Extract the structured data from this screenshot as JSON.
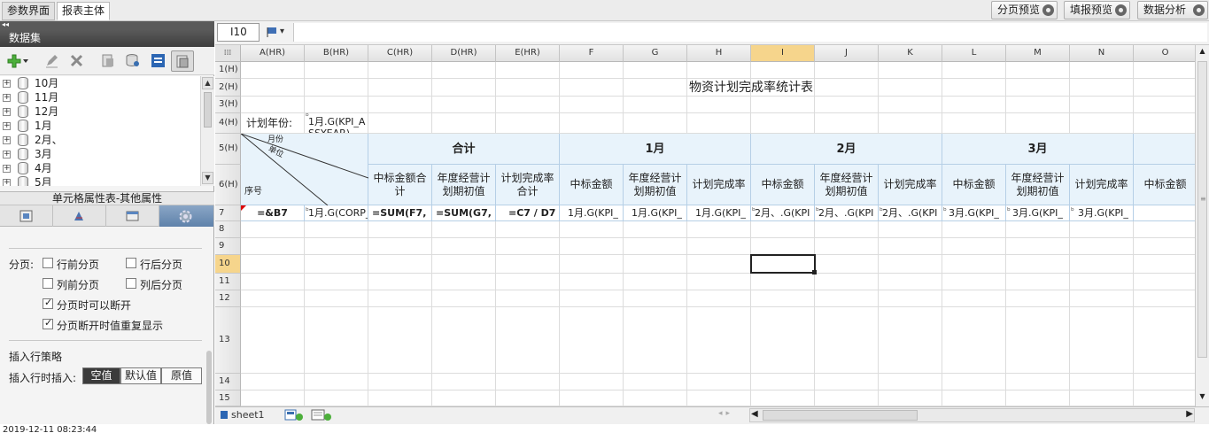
{
  "tabs": [
    {
      "label": "参数界面"
    },
    {
      "label": "报表主体"
    }
  ],
  "top_buttons": [
    {
      "label": "分页预览"
    },
    {
      "label": "填报预览"
    },
    {
      "label": "数据分析"
    }
  ],
  "dataset": {
    "title": "数据集",
    "items": [
      "10月",
      "11月",
      "12月",
      "1月",
      "2月、",
      "3月",
      "4月",
      "5月"
    ]
  },
  "props": {
    "title": "单元格属性表-其他属性",
    "paging_label": "分页:",
    "checks": [
      {
        "label": "行前分页",
        "checked": false
      },
      {
        "label": "行后分页",
        "checked": false
      },
      {
        "label": "列前分页",
        "checked": false
      },
      {
        "label": "列后分页",
        "checked": false
      },
      {
        "label": "分页时可以断开",
        "checked": true
      },
      {
        "label": "分页断开时值重复显示",
        "checked": true
      }
    ],
    "insert_title": "插入行策略",
    "insert_label": "插入行时插入:",
    "insert_options": [
      {
        "label": "空值",
        "active": true
      },
      {
        "label": "默认值",
        "active": false
      },
      {
        "label": "原值",
        "active": false
      }
    ]
  },
  "formula": {
    "cell_ref": "I10",
    "value": ""
  },
  "grid": {
    "columns": [
      "A(HR)",
      "B(HR)",
      "C(HR)",
      "D(HR)",
      "E(HR)",
      "F",
      "G",
      "H",
      "I",
      "J",
      "K",
      "L",
      "M",
      "N",
      "O"
    ],
    "selected_column": "I",
    "rows": [
      "1(H)",
      "2(H)",
      "3(H)",
      "4(H)",
      "5(H)",
      "6(H)",
      "7",
      "8",
      "9",
      "10",
      "11",
      "12",
      "13",
      "14",
      "15"
    ],
    "selected_row": "10",
    "report_title": "物资计划完成率统计表",
    "plan_year_label": "计划年份:",
    "plan_year_value": "1月.G(KPI_ASSYEAR)",
    "diag_month": "月份",
    "diag_unit": "单位",
    "diag_seq": "序号",
    "groups": [
      "合计",
      "1月",
      "2月",
      "3月"
    ],
    "subheaders": [
      "中标金额合计",
      "年度经营计划期初值",
      "计划完成率合计",
      "中标金额",
      "年度经营计划期初值",
      "计划完成率",
      "中标金额",
      "年度经营计划期初值",
      "计划完成率",
      "中标金额",
      "年度经营计划期初值",
      "计划完成率",
      "中标金额"
    ],
    "row7": [
      "=&B7",
      "1月.G(CORP_",
      "=SUM(F7,",
      "=SUM(G7,",
      "=C7 / D7",
      "1月.G(KPI_",
      "1月.G(KPI_",
      "1月.G(KPI_",
      "2月、.G(KPI",
      "2月、.G(KPI",
      "2月、.G(KPI",
      "3月.G(KPI_",
      "3月.G(KPI_",
      "3月.G(KPI_",
      ""
    ]
  },
  "sheet_tab": "sheet1",
  "status_text": "2019-12-11 08:23:44"
}
